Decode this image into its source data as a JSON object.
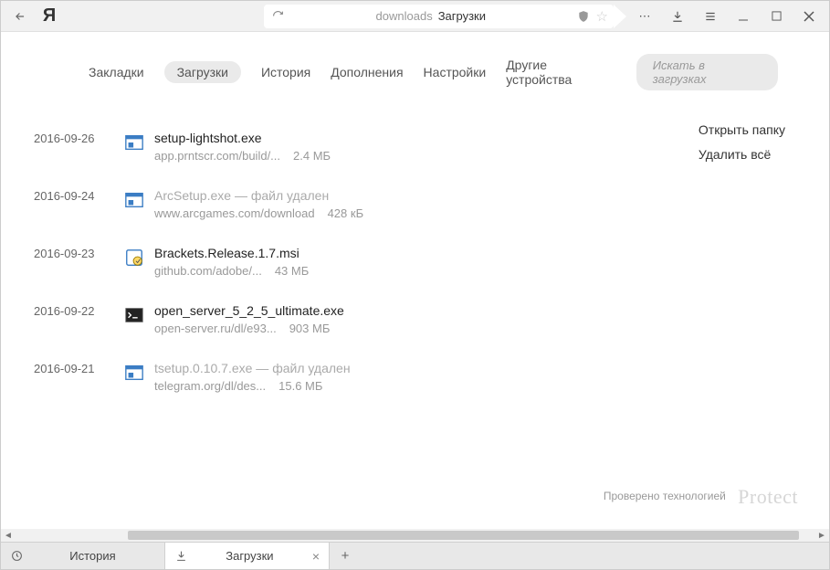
{
  "chrome": {
    "logo": "Я",
    "address": {
      "scheme": "downloads",
      "title": "Загрузки"
    }
  },
  "nav": {
    "items": [
      "Закладки",
      "Загрузки",
      "История",
      "Дополнения",
      "Настройки",
      "Другие устройства"
    ],
    "active_index": 1,
    "search_placeholder": "Искать в загрузках"
  },
  "actions": {
    "open_folder": "Открыть папку",
    "delete_all": "Удалить всё"
  },
  "downloads": [
    {
      "date": "2016-09-26",
      "name": "setup-lightshot.exe",
      "url": "app.prntscr.com/build/...",
      "size": "2.4 МБ",
      "deleted": false,
      "icon": "installer"
    },
    {
      "date": "2016-09-24",
      "name": "ArcSetup.exe — файл удален",
      "url": "www.arcgames.com/download",
      "size": "428 кБ",
      "deleted": true,
      "icon": "installer"
    },
    {
      "date": "2016-09-23",
      "name": "Brackets.Release.1.7.msi",
      "url": "github.com/adobe/...",
      "size": "43 МБ",
      "deleted": false,
      "icon": "msi"
    },
    {
      "date": "2016-09-22",
      "name": "open_server_5_2_5_ultimate.exe",
      "url": "open-server.ru/dl/e93...",
      "size": "903 МБ",
      "deleted": false,
      "icon": "terminal"
    },
    {
      "date": "2016-09-21",
      "name": "tsetup.0.10.7.exe — файл удален",
      "url": "telegram.org/dl/des...",
      "size": "15.6 МБ",
      "deleted": true,
      "icon": "installer"
    }
  ],
  "footer": {
    "checked_by": "Проверено технологией",
    "brand": "Protect"
  },
  "tabs": [
    {
      "label": "История",
      "icon": "clock",
      "active": false,
      "closable": false
    },
    {
      "label": "Загрузки",
      "icon": "download",
      "active": true,
      "closable": true
    }
  ]
}
